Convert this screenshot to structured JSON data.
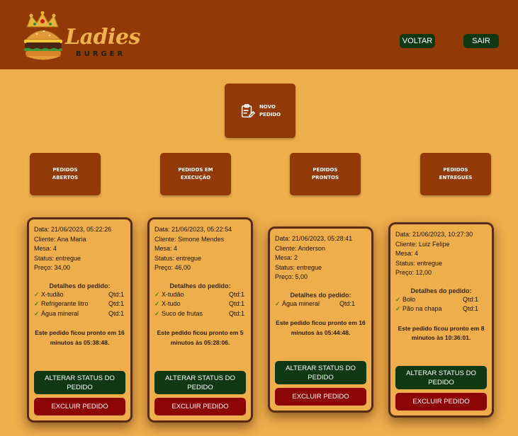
{
  "header": {
    "logo_title": "Ladies",
    "logo_subtitle": "BURGER",
    "back_label": "VOLTAR",
    "exit_label": "SAIR"
  },
  "new_order": {
    "label": "NOVO\nPEDIDO",
    "icon": "clipboard-edit-icon"
  },
  "filters": [
    {
      "label": "PEDIDOS\nABERTOS"
    },
    {
      "label": "PEDIDOS EM\nEXECUÇÃO"
    },
    {
      "label": "PEDIDOS\nPRONTOS"
    },
    {
      "label": "PEDIDOS\nENTREGUES"
    }
  ],
  "orders": [
    {
      "date_label": "Data:",
      "date": "21/06/2023, 05:22:26",
      "client_label": "Cliente:",
      "client": "Ana Maria",
      "table_label": "Mesa:",
      "table": "4",
      "status_label": "Status:",
      "status": "entregue",
      "price_label": "Preço:",
      "price": "34,00",
      "details_title": "Detalhes do pedido:",
      "items": [
        {
          "check": "✓",
          "name": "X-tudão",
          "qty": "Qtd:1"
        },
        {
          "check": "✓",
          "name": "Refrigerante litro",
          "qty": "Qtd:1"
        },
        {
          "check": "✓",
          "name": "Água mineral",
          "qty": "Qtd:1"
        }
      ],
      "ready_text": "Este pedido ficou pronto em 16 minutos às 05:38:48.",
      "status_button": "ALTERAR STATUS DO PEDIDO",
      "delete_button": "EXCLUIR PEDIDO"
    },
    {
      "date_label": "Data:",
      "date": "21/06/2023, 05:22:54",
      "client_label": "Cliente:",
      "client": "Simone Mendes",
      "table_label": "Mesa:",
      "table": "4",
      "status_label": "Status:",
      "status": "entregue",
      "price_label": "Preço:",
      "price": "46,00",
      "details_title": "Detalhes do pedido:",
      "items": [
        {
          "check": "✓",
          "name": "X-tudão",
          "qty": "Qtd:1"
        },
        {
          "check": "✓",
          "name": "X-tudo",
          "qty": "Qtd:1"
        },
        {
          "check": "✓",
          "name": "Suco de frutas",
          "qty": "Qtd:1"
        }
      ],
      "ready_text": "Este pedido ficou pronto em 5 minutos às 05:28:06.",
      "status_button": "ALTERAR STATUS DO PEDIDO",
      "delete_button": "EXCLUIR PEDIDO"
    },
    {
      "date_label": "Data:",
      "date": "21/06/2023, 05:28:41",
      "client_label": "Cliente:",
      "client": "Anderson",
      "table_label": "Mesa:",
      "table": "2",
      "status_label": "Status:",
      "status": "entregue",
      "price_label": "Preço:",
      "price": "5,00",
      "details_title": "Detalhes do pedido:",
      "items": [
        {
          "check": "✓",
          "name": "Água mineral",
          "qty": "Qtd:1"
        }
      ],
      "ready_text": "Este pedido ficou pronto em 16 minutos às 05:44:48.",
      "status_button": "ALTERAR STATUS DO PEDIDO",
      "delete_button": "EXCLUIR PEDIDO"
    },
    {
      "date_label": "Data:",
      "date": "21/06/2023, 10:27:30",
      "client_label": "Cliente:",
      "client": "Luiz Felipe",
      "table_label": "Mesa:",
      "table": "4",
      "status_label": "Status:",
      "status": "entregue",
      "price_label": "Preço:",
      "price": "12,00",
      "details_title": "Detalhes do pedido:",
      "items": [
        {
          "check": "✓",
          "name": "Bolo",
          "qty": "Qtd:1"
        },
        {
          "check": "✓",
          "name": "Pão na chapa",
          "qty": "Qtd:1"
        }
      ],
      "ready_text": "Este pedido ficou pronto em 8 minutos às 10:36:01.",
      "status_button": "ALTERAR STATUS DO PEDIDO",
      "delete_button": "EXCLUIR PEDIDO"
    }
  ],
  "colors": {
    "header_bg": "#923a07",
    "page_bg": "#efae4c",
    "primary_button": "#0f3813",
    "danger_button": "#8c0606",
    "card_border": "#5a2b14"
  }
}
